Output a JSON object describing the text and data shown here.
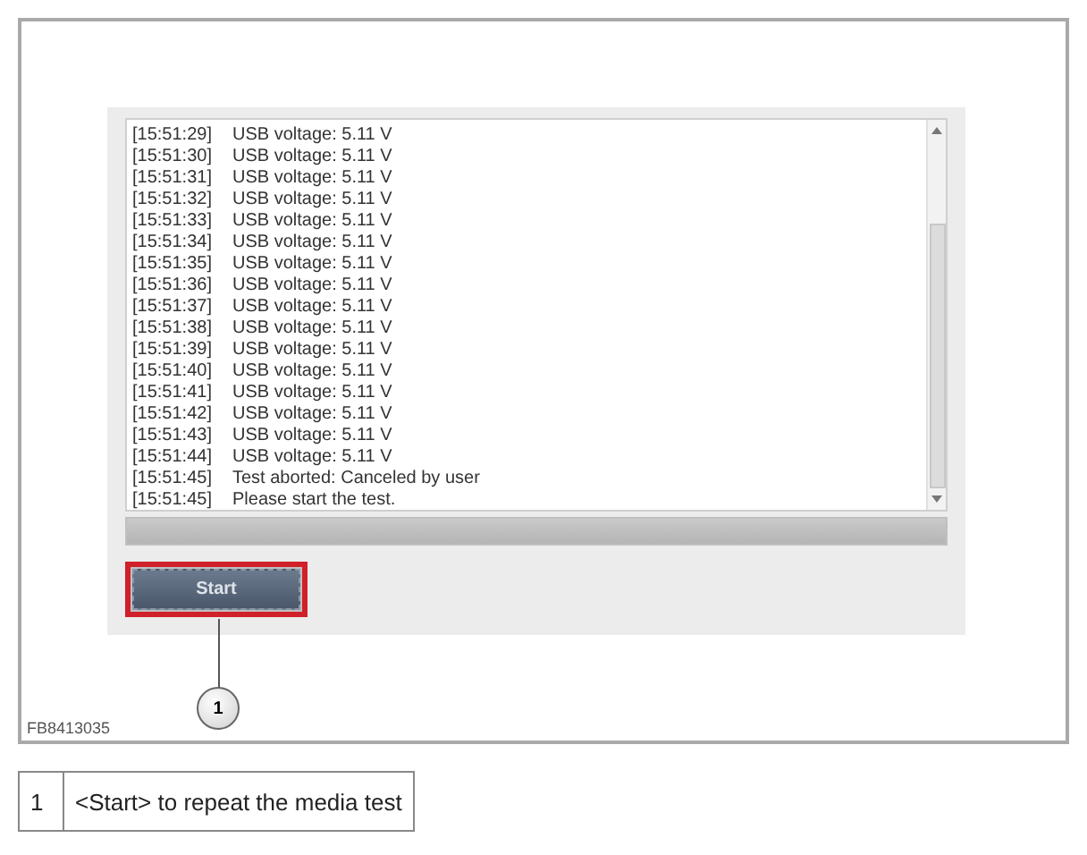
{
  "log": [
    {
      "time": "[15:51:29]",
      "message": "USB voltage: 5.11 V"
    },
    {
      "time": "[15:51:30]",
      "message": "USB voltage: 5.11 V"
    },
    {
      "time": "[15:51:31]",
      "message": "USB voltage: 5.11 V"
    },
    {
      "time": "[15:51:32]",
      "message": "USB voltage: 5.11 V"
    },
    {
      "time": "[15:51:33]",
      "message": "USB voltage: 5.11 V"
    },
    {
      "time": "[15:51:34]",
      "message": "USB voltage: 5.11 V"
    },
    {
      "time": "[15:51:35]",
      "message": "USB voltage: 5.11 V"
    },
    {
      "time": "[15:51:36]",
      "message": "USB voltage: 5.11 V"
    },
    {
      "time": "[15:51:37]",
      "message": "USB voltage: 5.11 V"
    },
    {
      "time": "[15:51:38]",
      "message": "USB voltage: 5.11 V"
    },
    {
      "time": "[15:51:39]",
      "message": "USB voltage: 5.11 V"
    },
    {
      "time": "[15:51:40]",
      "message": "USB voltage: 5.11 V"
    },
    {
      "time": "[15:51:41]",
      "message": "USB voltage: 5.11 V"
    },
    {
      "time": "[15:51:42]",
      "message": "USB voltage: 5.11 V"
    },
    {
      "time": "[15:51:43]",
      "message": "USB voltage: 5.11 V"
    },
    {
      "time": "[15:51:44]",
      "message": "USB voltage: 5.11 V"
    },
    {
      "time": "[15:51:45]",
      "message": "Test aborted: Canceled by user"
    },
    {
      "time": "[15:51:45]",
      "message": "Please start the test."
    }
  ],
  "start_button": {
    "label": "Start"
  },
  "callout": {
    "number": "1"
  },
  "figure_id": "FB8413035",
  "legend": [
    {
      "number": "1",
      "text": "<Start> to repeat the media test"
    }
  ]
}
